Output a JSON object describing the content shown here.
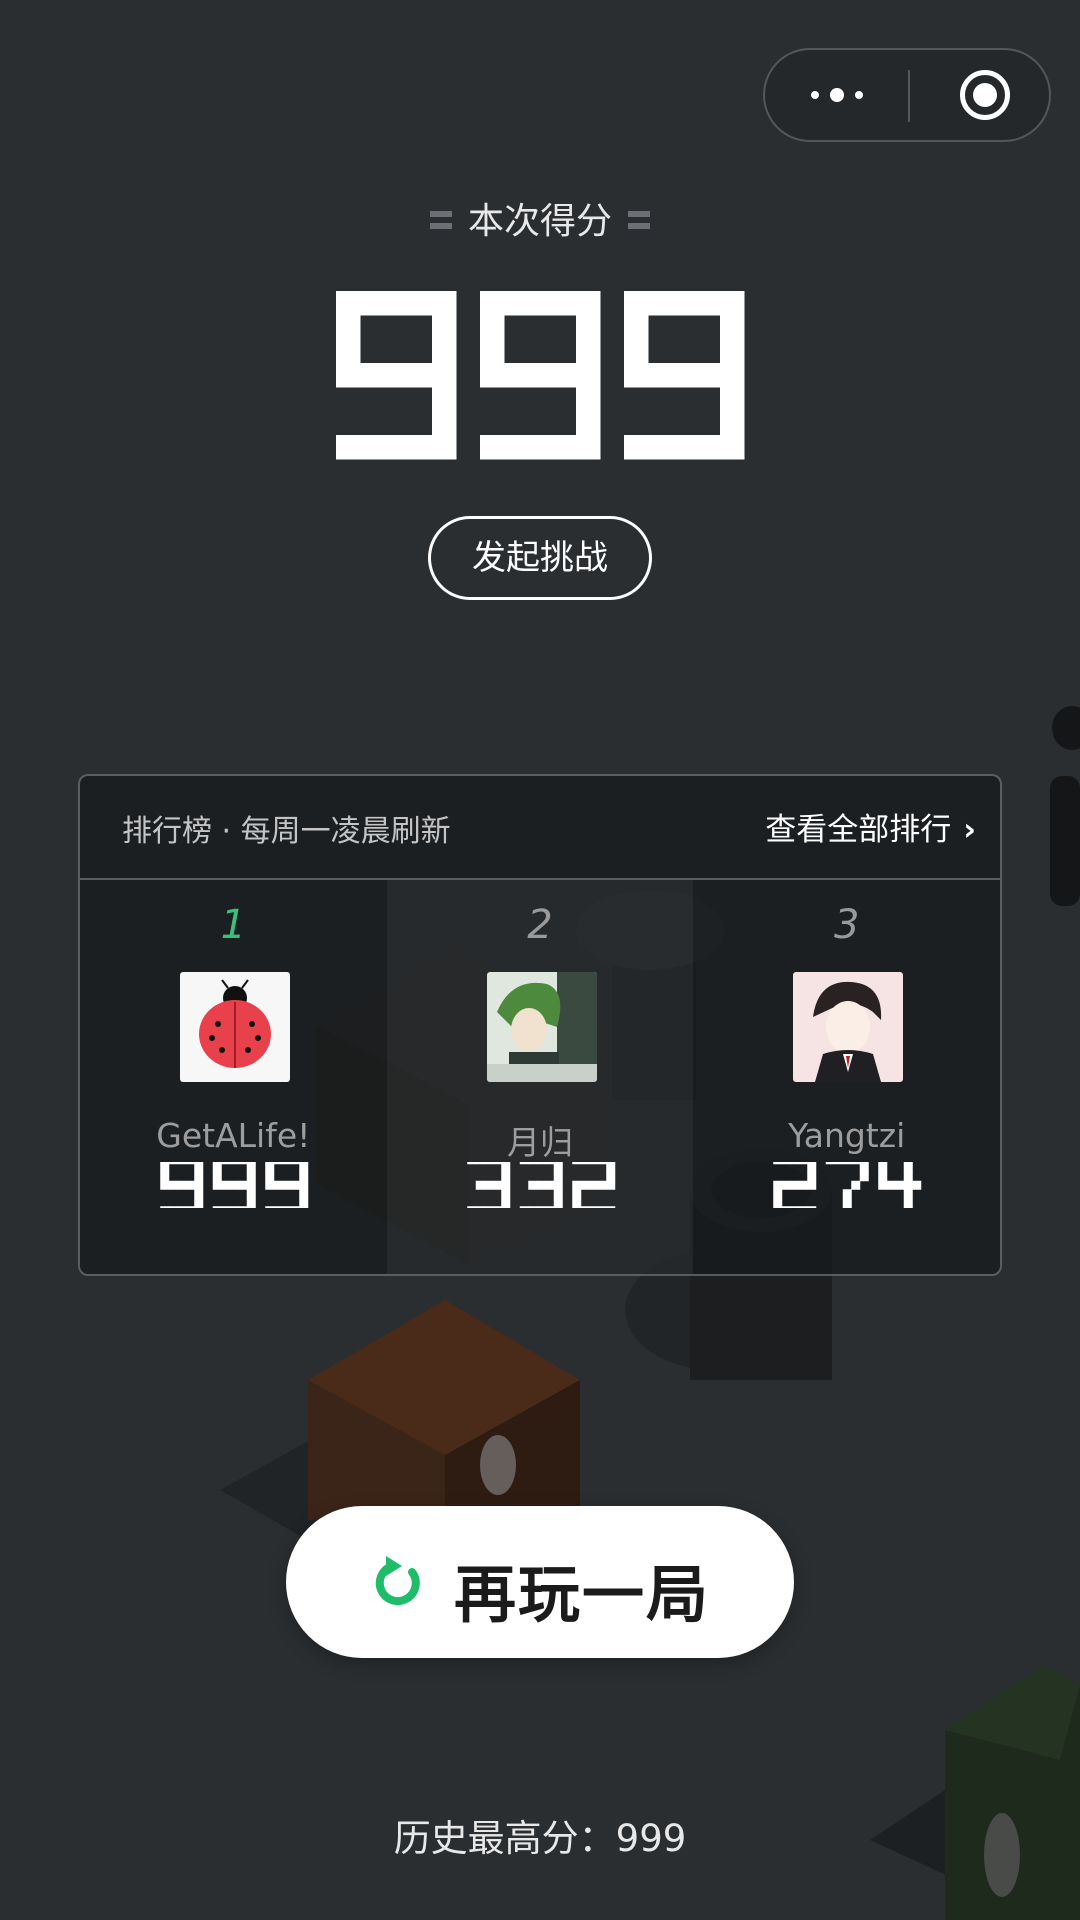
{
  "capsule": {
    "more_icon": "more-dots-icon",
    "close_icon": "target-close-icon"
  },
  "score_label": "本次得分",
  "current_score": "999",
  "challenge_button": "发起挑战",
  "leaderboard": {
    "title": "排行榜 · 每周一凌晨刷新",
    "view_all": "查看全部排行",
    "players": [
      {
        "rank": "1",
        "name": "GetALife!",
        "score": "999",
        "avatar": "ladybug-avatar"
      },
      {
        "rank": "2",
        "name": "月归",
        "score": "332",
        "avatar": "anime-green-hair-avatar"
      },
      {
        "rank": "3",
        "name": "Yangtzi",
        "score": "274",
        "avatar": "anime-suit-avatar"
      }
    ]
  },
  "play_again": "再玩一局",
  "best_score": "历史最高分：999",
  "colors": {
    "accent": "#39c07a",
    "background": "#2a2e31"
  }
}
